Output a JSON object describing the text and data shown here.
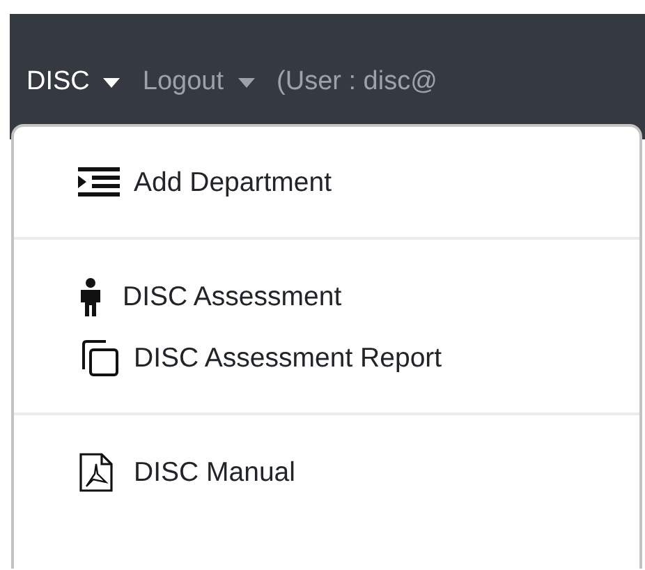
{
  "navbar": {
    "items": [
      {
        "label": "DISC",
        "kind": "dropdown",
        "active": true
      },
      {
        "label": "Logout",
        "kind": "dropdown",
        "active": false
      },
      {
        "label": "(User : disc@",
        "kind": "text",
        "active": false
      }
    ]
  },
  "menu": {
    "groups": [
      [
        {
          "label": "Add Department",
          "kind": "indent"
        }
      ],
      [
        {
          "label": "DISC Assessment",
          "kind": "person"
        },
        {
          "label": "DISC Assessment Report",
          "kind": "copy"
        }
      ],
      [
        {
          "label": "DISC Manual",
          "kind": "pdf"
        }
      ]
    ]
  }
}
